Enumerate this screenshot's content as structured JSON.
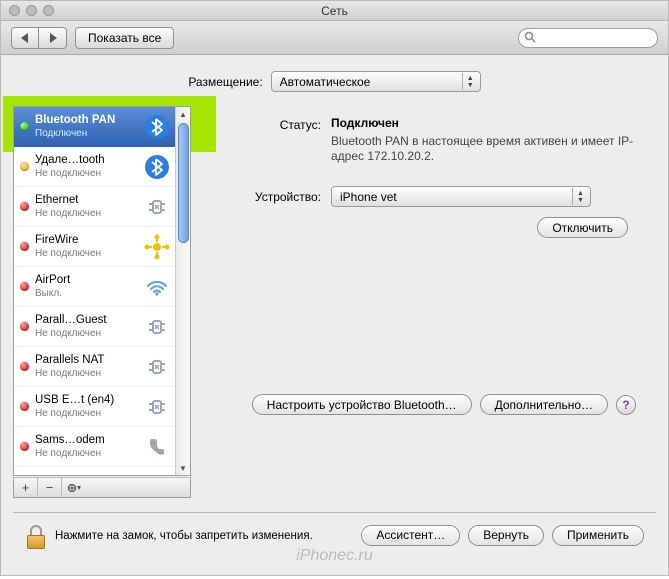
{
  "window": {
    "title": "Сеть"
  },
  "toolbar": {
    "show_all": "Показать все",
    "search_placeholder": ""
  },
  "location": {
    "label": "Размещение:",
    "value": "Автоматическое"
  },
  "sidebar": {
    "items": [
      {
        "name": "Bluetooth PAN",
        "sub": "Подключен",
        "status": "green",
        "icon": "bluetooth",
        "selected": true
      },
      {
        "name": "Удале…tooth",
        "sub": "Не подключен",
        "status": "orange",
        "icon": "bluetooth"
      },
      {
        "name": "Ethernet",
        "sub": "Не подключен",
        "status": "red",
        "icon": "ethernet"
      },
      {
        "name": "FireWire",
        "sub": "Не подключен",
        "status": "red",
        "icon": "firewire"
      },
      {
        "name": "AirPort",
        "sub": "Выкл.",
        "status": "red",
        "icon": "wifi"
      },
      {
        "name": "Parall…Guest",
        "sub": "Не подключен",
        "status": "red",
        "icon": "ethernet"
      },
      {
        "name": "Parallels NAT",
        "sub": "Не подключен",
        "status": "red",
        "icon": "ethernet"
      },
      {
        "name": "USB E…t (en4)",
        "sub": "Не подключен",
        "status": "red",
        "icon": "ethernet"
      },
      {
        "name": "Sams…odem",
        "sub": "Не подключен",
        "status": "red",
        "icon": "phone"
      }
    ]
  },
  "detail": {
    "status_label": "Статус:",
    "status_value": "Подключен",
    "status_desc": "Bluetooth PAN в настоящее время активен и имеет IP-адрес 172.10.20.2.",
    "device_label": "Устройство:",
    "device_value": "iPhone vet",
    "disconnect": "Отключить",
    "configure_bt": "Настроить устройство Bluetooth…",
    "advanced": "Дополнительно…"
  },
  "lock": {
    "text": "Нажмите на замок, чтобы запретить изменения."
  },
  "footer": {
    "assist": "Ассистент…",
    "revert": "Вернуть",
    "apply": "Применить"
  },
  "watermark": "iPhonec.ru"
}
